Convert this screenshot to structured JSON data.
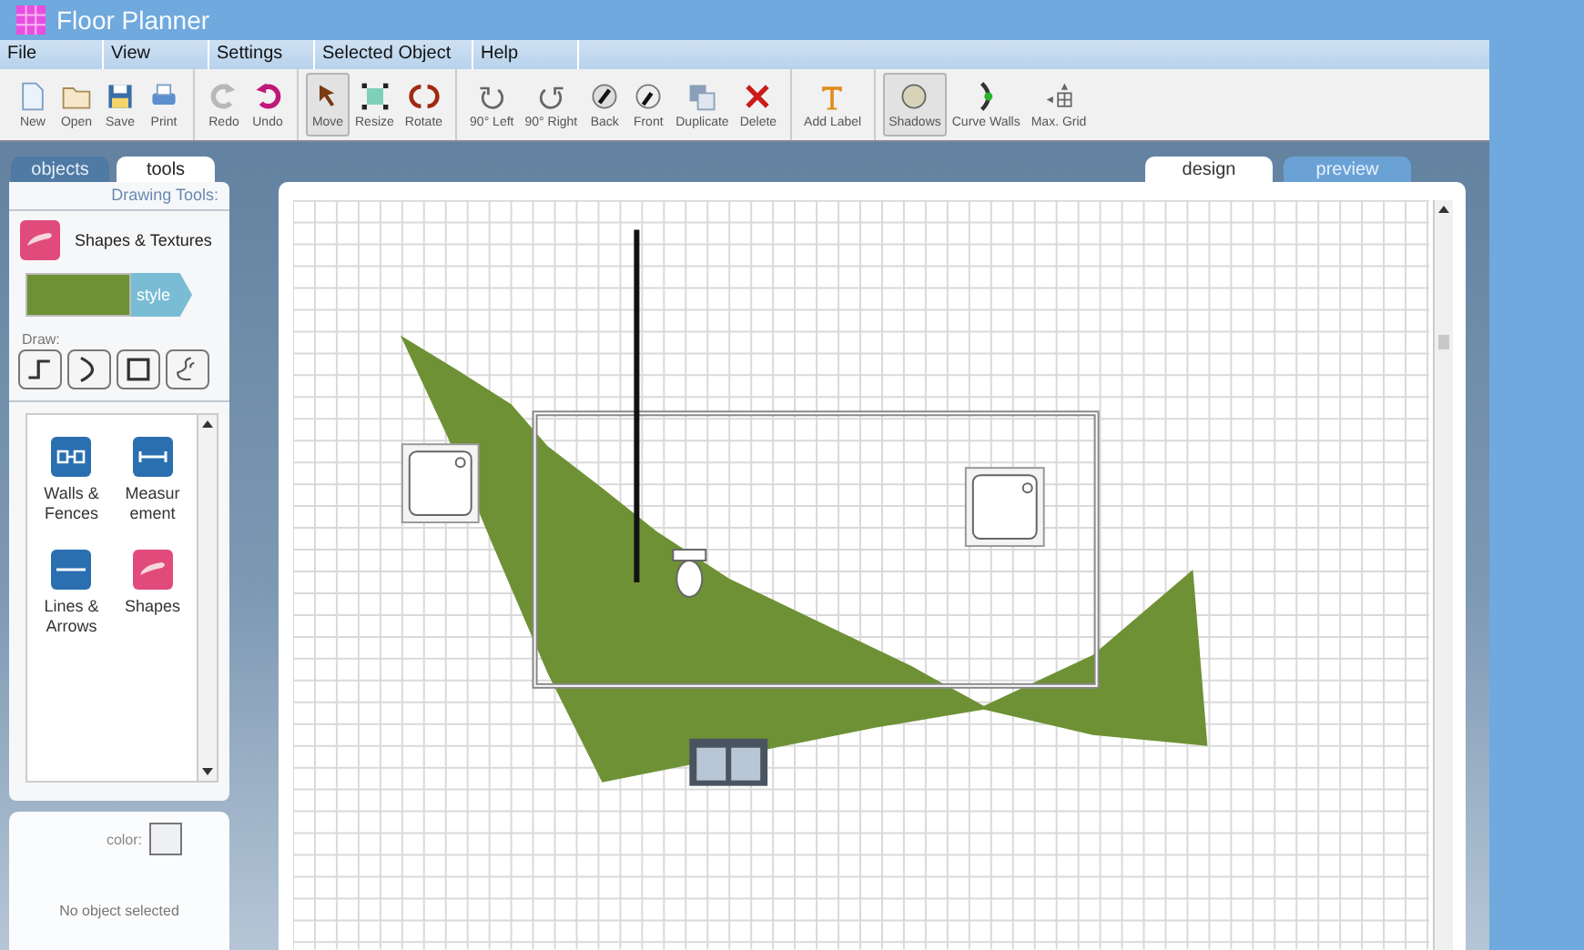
{
  "window": {
    "title": "Floor Planner"
  },
  "menu": [
    "File",
    "View",
    "Settings",
    "Selected Object",
    "Help"
  ],
  "toolbar": {
    "groups": [
      {
        "buttons": [
          {
            "label": "New",
            "pressed": false
          },
          {
            "label": "Open",
            "pressed": false
          },
          {
            "label": "Save",
            "pressed": false
          },
          {
            "label": "Print",
            "pressed": false
          }
        ]
      },
      {
        "buttons": [
          {
            "label": "Redo",
            "pressed": false
          },
          {
            "label": "Undo",
            "pressed": false
          }
        ]
      },
      {
        "buttons": [
          {
            "label": "Move",
            "pressed": true
          },
          {
            "label": "Resize",
            "pressed": false
          },
          {
            "label": "Rotate",
            "pressed": false
          }
        ]
      },
      {
        "buttons": [
          {
            "label": "90° Left",
            "pressed": false
          },
          {
            "label": "90° Right",
            "pressed": false
          },
          {
            "label": "Back",
            "pressed": false
          },
          {
            "label": "Front",
            "pressed": false
          },
          {
            "label": "Duplicate",
            "pressed": false
          },
          {
            "label": "Delete",
            "pressed": false
          }
        ]
      },
      {
        "buttons": [
          {
            "label": "Add Label",
            "pressed": false
          }
        ]
      },
      {
        "buttons": [
          {
            "label": "Shadows",
            "pressed": true
          },
          {
            "label": "Curve Walls",
            "pressed": false
          },
          {
            "label": "Max. Grid",
            "pressed": false
          }
        ]
      }
    ]
  },
  "side_tabs": [
    {
      "label": "objects",
      "selected": false
    },
    {
      "label": "tools",
      "selected": true
    }
  ],
  "tools_panel": {
    "heading": "Drawing Tools:",
    "tool_name": "Shapes & Textures",
    "style_button": "style",
    "draw_label": "Draw:",
    "items": [
      {
        "label": "Walls & Fences"
      },
      {
        "label": "Measurement"
      },
      {
        "label": "Lines & Arrows"
      },
      {
        "label": "Shapes"
      }
    ]
  },
  "properties_panel": {
    "color_label": "color:",
    "status": "No object selected"
  },
  "view_tabs": [
    {
      "label": "design",
      "selected": true
    },
    {
      "label": "preview",
      "selected": false
    }
  ]
}
